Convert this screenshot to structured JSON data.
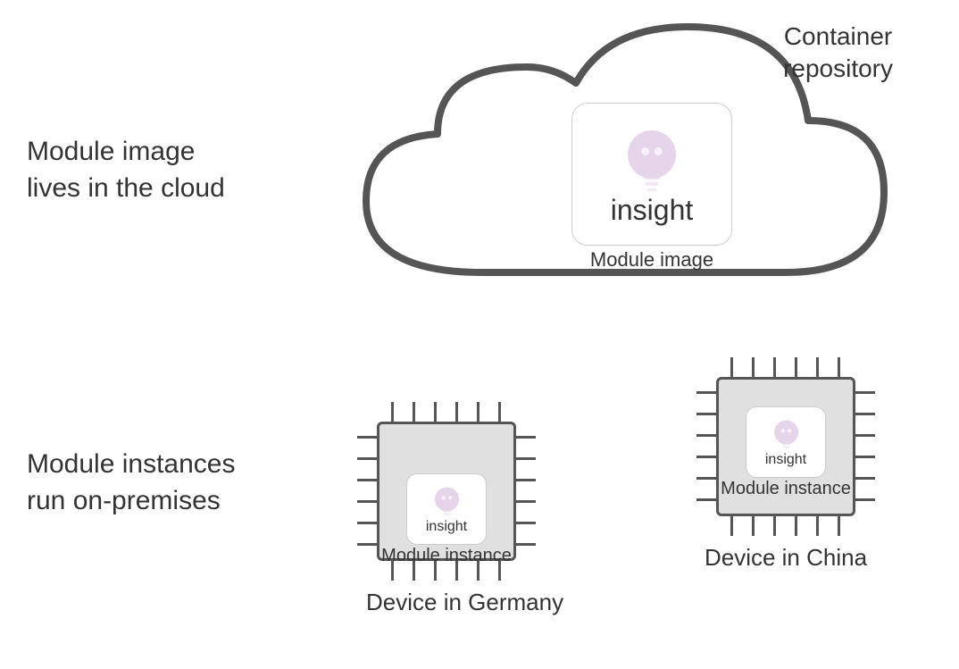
{
  "leftLabels": {
    "top": "Module image\nlives in the cloud",
    "bottom": "Module instances\nrun on-premises"
  },
  "cloud": {
    "title": "Container\nrepository",
    "moduleCard": {
      "label": "insight",
      "sublabel": "Module image"
    }
  },
  "devices": [
    {
      "caption": "Device in Germany",
      "moduleCard": {
        "label": "insight",
        "sublabel": "Module instance"
      }
    },
    {
      "caption": "Device in China",
      "moduleCard": {
        "label": "insight",
        "sublabel": "Module instance"
      }
    }
  ]
}
